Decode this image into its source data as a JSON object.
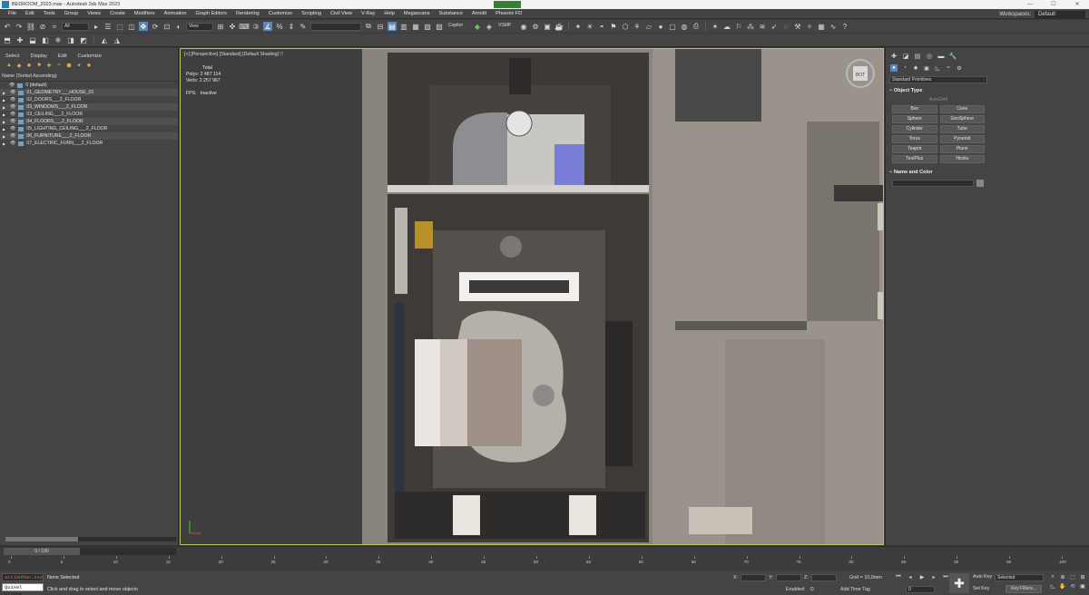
{
  "window": {
    "title": "BEDROOM_2023.max - Autodesk 3ds Max 2023",
    "controls": [
      "—",
      "☐",
      "✕"
    ]
  },
  "menu": {
    "items": [
      "File",
      "Edit",
      "Tools",
      "Group",
      "Views",
      "Create",
      "Modifiers",
      "Animation",
      "Graph Editors",
      "Rendering",
      "Customize",
      "Scripting",
      "Civil View",
      "V-Ray",
      "Help",
      "Megascans",
      "Substance",
      "Arnold",
      "Phoenix FD"
    ],
    "workspaces_label": "Workspaces:",
    "workspaces_value": "Default"
  },
  "toolbar": {
    "selection_filter": "All",
    "reference_coord": "View",
    "named_selection": "",
    "copy_label": "Copitor",
    "vray_label": "VSMP"
  },
  "scene_explorer": {
    "menu": [
      "Select",
      "Display",
      "Edit",
      "Customize"
    ],
    "header": "Name (Sorted Ascending)",
    "default_layer": "0 (default)",
    "layers": [
      "01_GEOMETRY___HOUSE_01",
      "02_DOORS___2_FLOOR",
      "03_WINDOWS___2_FLOOR",
      "03_CEILING___2_FLOOR",
      "04_FLOORS___2_FLOOR",
      "05_LIGHTING_CEILING___2_FLOOR",
      "06_FURNITURE___2_FLOOR",
      "07_ELECTRIC_FURN___2_FLOOR"
    ]
  },
  "viewport": {
    "label": "[+] [Perspective] [Standard] [Default Shading]",
    "filter_icon": "▽",
    "stats": {
      "total_label": "Total",
      "polys_label": "Polys:",
      "polys_value": "2 487 114",
      "verts_label": "Verts:",
      "verts_value": "2 257 967",
      "fps_label": "FPS:",
      "fps_value": "Inactive"
    },
    "viewcube_label": "BOT"
  },
  "command_panel": {
    "category": "Standard Primitives",
    "object_type_title": "Object Type",
    "autogrid": "AutoGrid",
    "objects": [
      "Box",
      "Cone",
      "Sphere",
      "GeoSphere",
      "Cylinder",
      "Tube",
      "Torus",
      "Pyramid",
      "Teapot",
      "Plane",
      "TextPlus",
      "Hedra"
    ],
    "name_color_title": "Name and Color",
    "rollout_toggle": "−"
  },
  "timeline": {
    "frame_display": "0 / 100",
    "ticks": [
      "0",
      "5",
      "10",
      "15",
      "20",
      "25",
      "30",
      "35",
      "40",
      "45",
      "50",
      "55",
      "60",
      "65",
      "70",
      "75",
      "80",
      "85",
      "90",
      "95",
      "100"
    ]
  },
  "status": {
    "maxscript_line1": "actionMan.exe",
    "maxscript_line2": "Quixel Bridge",
    "message": "None Selected",
    "prompt": "Click and drag to select and move objects",
    "x_label": "X:",
    "y_label": "Y:",
    "z_label": "Z:",
    "grid_label": "Grid = 10,0mm",
    "enabled_label": "Enabled:",
    "add_time_tag": "Add Time Tag",
    "frame_value": "0",
    "auto_key": "Auto Key",
    "set_key": "Set Key",
    "selected_value": "Selected",
    "key_filters": "Key Filters..."
  },
  "colors": {
    "accent": "#5a87b8",
    "viewport_border": "#bfbf60",
    "maxscript_error": "#e06060"
  }
}
